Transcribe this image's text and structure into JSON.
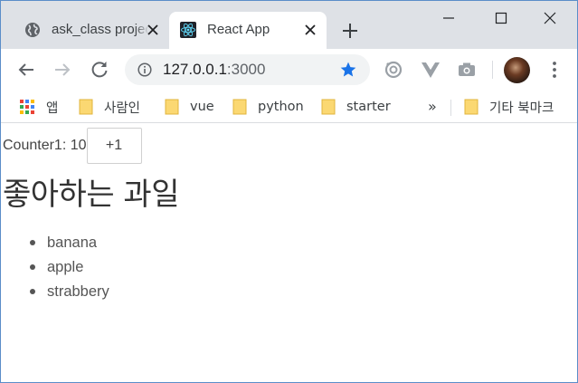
{
  "browser": {
    "tabs": [
      {
        "title": "ask_class project"
      },
      {
        "title": "React App"
      }
    ],
    "address": {
      "host": "127.0.0.1",
      "port": ":3000"
    },
    "bookmarks": [
      {
        "label": "앱",
        "icon": "apps-grid-icon"
      },
      {
        "label": "사람인",
        "icon": "folder-icon"
      },
      {
        "label": "vue",
        "icon": "folder-icon"
      },
      {
        "label": "python",
        "icon": "folder-icon"
      },
      {
        "label": "starter",
        "icon": "folder-icon"
      }
    ],
    "bookmarks_overflow": "»",
    "other_bookmarks": "기타 북마크",
    "colors": {
      "tab_strip": "#dee1e6",
      "star": "#1a73e8",
      "folder": "#fbd872"
    }
  },
  "page": {
    "counter_label": "Counter1: 10",
    "increment_button": "+1",
    "heading": "좋아하는 과일",
    "fruits": [
      "banana",
      "apple",
      "strabbery"
    ]
  }
}
